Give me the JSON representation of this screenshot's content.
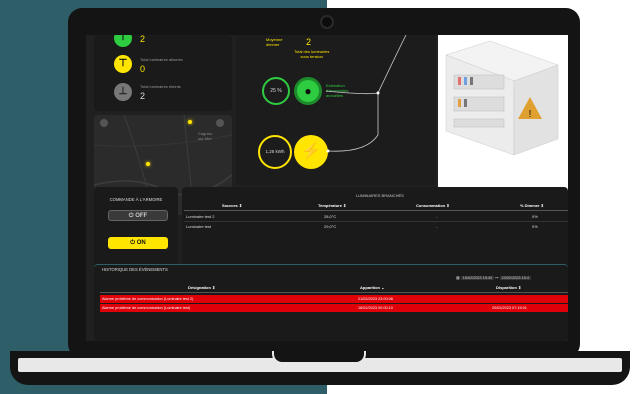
{
  "stats": {
    "top_value": "2",
    "lit_label": "Total luminaires allumés",
    "lit_value": "0",
    "off_label": "Total luminaires éteints",
    "off_value": "2"
  },
  "center": {
    "avg_label": "Moyenne\ndimmer",
    "avg_value": "2",
    "powered_label": "Total des luminaires\nsous tension",
    "percent_value": "25 %",
    "water_label": "Estimation\nd'économies\nannuelles",
    "energy_value": "1,25 kWh"
  },
  "map": {
    "city_label": "Cagnes-\nsur-Mer"
  },
  "command": {
    "title": "COMMANDE À L'ARMOIRE",
    "off_label": "OFF",
    "on_label": "ON"
  },
  "table": {
    "title": "LUMINAIRES BRANCHÉS",
    "headers": [
      "Sources ⇕",
      "Température ⇕",
      "Consommation ⇕",
      "% Dimmer ⇕"
    ],
    "rows": [
      [
        "Luminaire test 2",
        "28,0°C",
        "-",
        "0%"
      ],
      [
        "Luminaire test",
        "29,0°C",
        "-",
        "0%"
      ]
    ]
  },
  "history": {
    "title": "HISTORIQUE DES ÉVÉNEMENTS",
    "date_from": "16/02/2023 15:40",
    "date_to": "23/02/2023 15:4",
    "headers": [
      "Désignation ⇕",
      "Apparition ⌄",
      "Disparition ⇕"
    ],
    "rows": [
      [
        "Alarme problème de communication (Luminaire test 2)",
        "21/02/2023 23:00:08",
        ""
      ],
      [
        "Alarme problème de communication (Luminaire test)",
        "16/02/2023 00:00:10",
        "20/02/2023 07:15:01"
      ]
    ]
  },
  "colors": {
    "accent_yellow": "#ffe500",
    "accent_green": "#2ecc40",
    "alarm_red": "#e0000a",
    "teal_bg": "#2e5f68"
  }
}
